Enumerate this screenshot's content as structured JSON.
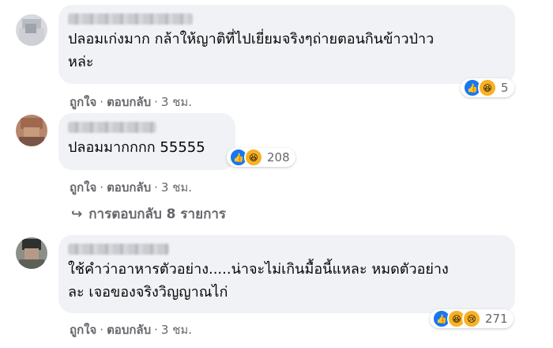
{
  "comments": [
    {
      "text_line1": "ปลอมเก่งมาก กล้าให้ญาติที่ไปเยี่ยมจริงๆถ่ายตอนกินข้าวป่าว",
      "text_line2": "หล่ะ",
      "like_label": "ถูกใจ",
      "reply_label": "ตอบกลับ",
      "time": "3 ชม.",
      "reactions": [
        "like-icon",
        "haha-icon"
      ],
      "reaction_count": "5"
    },
    {
      "text_line1": "ปลอมมากกกก 55555",
      "like_label": "ถูกใจ",
      "reply_label": "ตอบกลับ",
      "time": "3 ชม.",
      "reactions": [
        "like-icon",
        "haha-icon"
      ],
      "reaction_count": "208"
    },
    {
      "text_line1": "ใช้คำว่าอาหารตัวอย่าง.....น่าจะไม่เกินมื้อนี้แหละ หมดตัวอย่าง",
      "text_line2": "ละ เจอของจริงวิญญาณไก่",
      "like_label": "ถูกใจ",
      "reply_label": "ตอบกลับ",
      "time": "3 ชม.",
      "reactions": [
        "like-icon",
        "haha-icon",
        "sad-icon"
      ],
      "reaction_count": "271"
    }
  ],
  "replies_link": "การตอบกลับ 8 รายการ",
  "colors": {
    "bubble": "#f0f2f5",
    "secondary_text": "#65676b",
    "like_blue": "#1877f2",
    "emoji_yellow": "#f7b125"
  }
}
